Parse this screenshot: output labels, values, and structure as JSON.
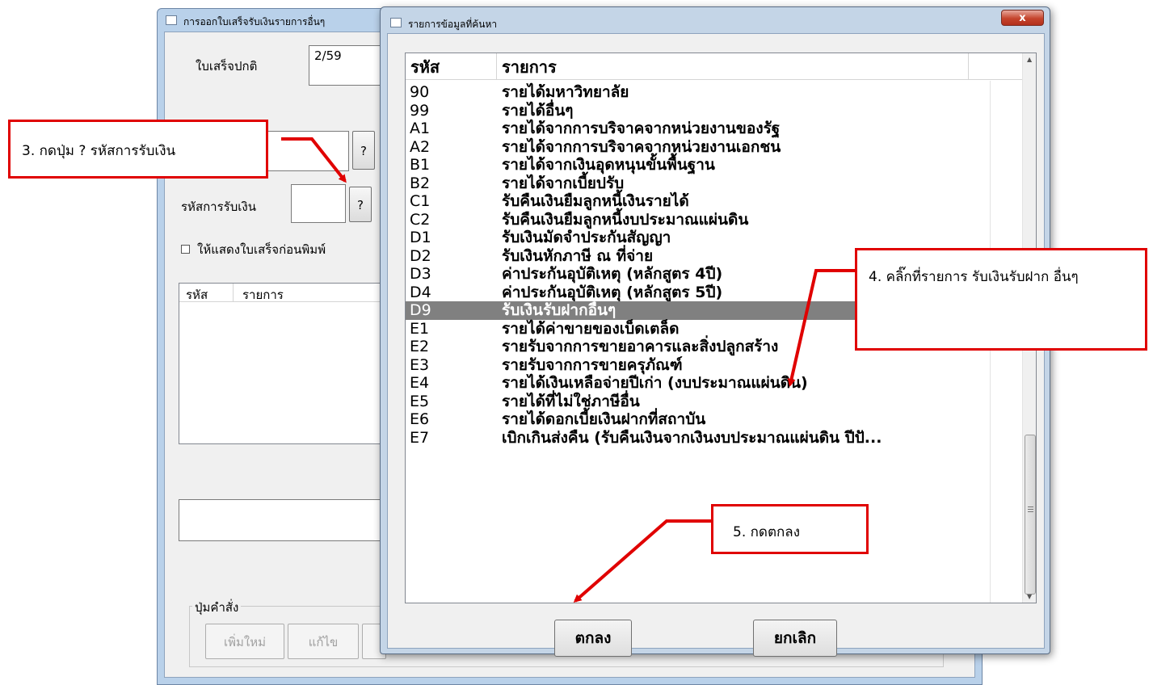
{
  "background_window": {
    "title": "การออกใบเสร็จรับเงินรายการอื่นๆ",
    "receipt_label": "ใบเสร็จปกติ",
    "receipt_value": "2/59",
    "question_label": "?",
    "receipt_code_label": "รหัสการรับเงิน",
    "preview_checkbox_label": "ให้แสดงใบเสร็จก่อนพิมพ์",
    "grid_columns": [
      "รหัส",
      "รายการ"
    ],
    "command_group_label": "ปุ่มคำสั่ง",
    "buttons": [
      "เพิ่มใหม่",
      "แก้ไข"
    ]
  },
  "dialog": {
    "title": "รายการข้อมูลที่ค้นหา",
    "close_label": "x",
    "columns": [
      "รหัส",
      "รายการ"
    ],
    "rows": [
      {
        "code": "90",
        "name": "รายได้มหาวิทยาลัย"
      },
      {
        "code": "99",
        "name": "รายได้อื่นๆ"
      },
      {
        "code": "A1",
        "name": "รายได้จากการบริจาคจากหน่วยงานของรัฐ"
      },
      {
        "code": "A2",
        "name": "รายได้จากการบริจาคจากหน่วยงานเอกชน"
      },
      {
        "code": "B1",
        "name": "รายได้จากเงินอุดหนุนขั้นพื้นฐาน"
      },
      {
        "code": "B2",
        "name": "รายได้จากเบี้ยปรับ"
      },
      {
        "code": "C1",
        "name": "รับคืนเงินยืมลูกหนี้เงินรายได้"
      },
      {
        "code": "C2",
        "name": "รับคืนเงินยืมลูกหนี้งบประมาณแผ่นดิน"
      },
      {
        "code": "D1",
        "name": "รับเงินมัดจำประกันสัญญา"
      },
      {
        "code": "D2",
        "name": "รับเงินหักภาษี ณ ที่จ่าย"
      },
      {
        "code": "D3",
        "name": "ค่าประกันอุบัติเหตุ (หลักสูตร 4ปี)"
      },
      {
        "code": "D4",
        "name": "ค่าประกันอุบัติเหตุ (หลักสูตร 5ปี)"
      },
      {
        "code": "D9",
        "name": "รับเงินรับฝากอื่นๆ"
      },
      {
        "code": "E1",
        "name": "รายได้ค่าขายของเบ็ดเตล็ด"
      },
      {
        "code": "E2",
        "name": "รายรับจากการขายอาคารและสิ่งปลูกสร้าง"
      },
      {
        "code": "E3",
        "name": "รายรับจากการขายครุภัณฑ์"
      },
      {
        "code": "E4",
        "name": "รายได้เงินเหลือจ่ายปีเก่า (งบประมาณแผ่นดิน)"
      },
      {
        "code": "E5",
        "name": "รายได้ที่ไม่ใช่ภาษีอื่น"
      },
      {
        "code": "E6",
        "name": "รายได้ดอกเบี้ยเงินฝากที่สถาบัน"
      },
      {
        "code": "E7",
        "name": "เบิกเกินส่งคืน (รับคืนเงินจากเงินงบประมาณแผ่นดิน ปีปั..."
      }
    ],
    "selected_code": "D9",
    "ok_label": "ตกลง",
    "cancel_label": "ยกเลิก"
  },
  "annotations": {
    "step3": "3. กดปุ่ม ? รหัสการรับเงิน",
    "step4": "4. คลิ๊กที่รายการ  รับเงินรับฝาก อื่นๆ",
    "step5": "5. กดตกลง"
  },
  "colors": {
    "annotation_red": "#e00000",
    "selection": "#808080"
  }
}
